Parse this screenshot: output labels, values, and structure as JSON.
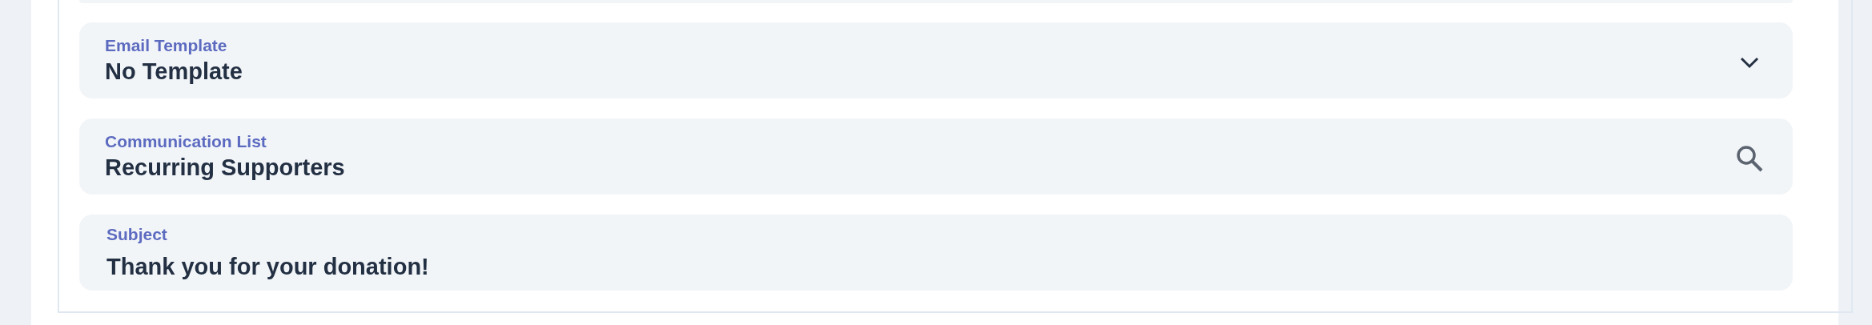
{
  "fields": [
    {
      "kind": "select",
      "label": "Email Template",
      "value": "No Template"
    },
    {
      "kind": "lookup",
      "label": "Communication List",
      "value": "Recurring Supporters"
    },
    {
      "kind": "text",
      "label": "Subject",
      "value": "Thank you for your donation!"
    }
  ]
}
